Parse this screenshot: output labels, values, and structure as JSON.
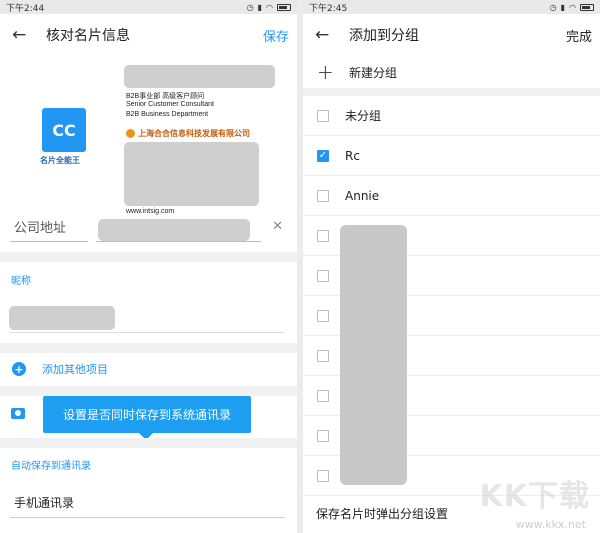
{
  "left_screen": {
    "status_time": "下午2:44",
    "header": {
      "title": "核对名片信息",
      "save_label": "保存"
    },
    "card": {
      "logo_text": "CC",
      "logo_caption": "名片全能王",
      "lines": [
        "B2B事业部  高级客户顾问",
        "Senior Customer Consultant",
        "B2B Business Department"
      ],
      "company": "上海合合信息科技发展有限公司",
      "website": "www.intsig.com"
    },
    "address_label": "公司地址",
    "nickname_label": "昵称",
    "add_more_label": "添加其他项目",
    "tooltip": "设置是否同时保存到系统通讯录",
    "autosave_label": "自动保存到通讯录",
    "contacts_value": "手机通讯录"
  },
  "right_screen": {
    "status_time": "下午2:45",
    "header": {
      "title": "添加到分组",
      "done_label": "完成"
    },
    "new_group_label": "新建分组",
    "groups": [
      {
        "label": "未分组",
        "checked": false
      },
      {
        "label": "Rc",
        "checked": true
      },
      {
        "label": "Annie",
        "checked": false
      },
      {
        "label": "",
        "checked": false
      },
      {
        "label": "",
        "checked": false
      },
      {
        "label": "",
        "checked": false
      },
      {
        "label": "",
        "checked": false
      },
      {
        "label": "",
        "checked": false
      },
      {
        "label": "",
        "checked": false
      },
      {
        "label": "",
        "checked": false
      }
    ],
    "footer_text": "保存名片时弹出分组设置"
  },
  "watermark": {
    "logo": "KK下载",
    "url": "www.kkx.net"
  },
  "colors": {
    "accent": "#2196f3",
    "tooltip": "#1e9ef0",
    "status_bar": "#e9e9e9"
  }
}
